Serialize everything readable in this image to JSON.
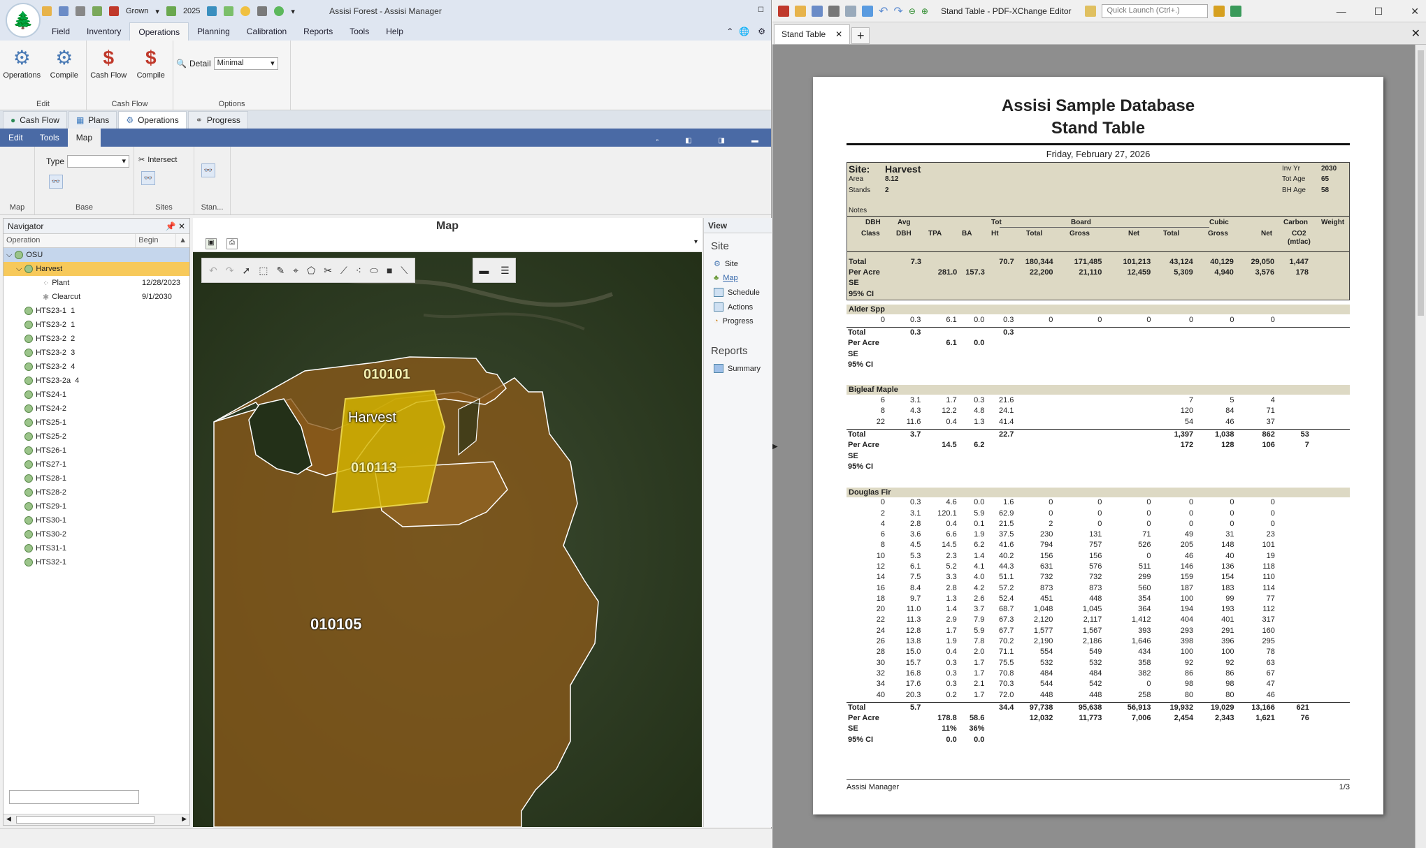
{
  "app": {
    "title": "Assisi Forest - Assisi Manager",
    "qat": {
      "grown_label": "Grown",
      "year": "2025"
    },
    "menu": [
      "Field",
      "Inventory",
      "Operations",
      "Planning",
      "Calibration",
      "Reports",
      "Tools",
      "Help"
    ],
    "active_menu": "Operations",
    "ribbon": {
      "edit": {
        "label": "Edit",
        "buttons": [
          "Operations",
          "Compile"
        ]
      },
      "cashflow": {
        "label": "Cash Flow",
        "buttons": [
          "Cash Flow",
          "Compile"
        ]
      },
      "options": {
        "label": "Options",
        "detail_label": "Detail",
        "detail_value": "Minimal"
      }
    },
    "doc_tabs": [
      "Cash Flow",
      "Plans",
      "Operations",
      "Progress"
    ],
    "active_doc_tab": "Operations",
    "sub_tabs": [
      "Edit",
      "Tools",
      "Map"
    ],
    "active_sub_tab": "Map",
    "sub_ribbon": {
      "map_label": "Map",
      "base_label": "Base",
      "type_label": "Type",
      "sites_label": "Sites",
      "intersect_label": "Intersect",
      "stand_label": "Stan..."
    },
    "navigator": {
      "title": "Navigator",
      "col_operation": "Operation",
      "col_begin": "Begin",
      "root": "OSU",
      "selected": "Harvest",
      "children": [
        {
          "label": "Plant",
          "date": "12/28/2023"
        },
        {
          "label": "Clearcut",
          "date": "9/1/2030"
        }
      ],
      "items": [
        "HTS23-1  1",
        "HTS23-2  1",
        "HTS23-2  2",
        "HTS23-2  3",
        "HTS23-2  4",
        "HTS23-2a  4",
        "HTS24-1",
        "HTS24-2",
        "HTS25-1",
        "HTS25-2",
        "HTS26-1",
        "HTS27-1",
        "HTS28-1",
        "HTS28-2",
        "HTS29-1",
        "HTS30-1",
        "HTS30-2",
        "HTS31-1",
        "HTS32-1"
      ]
    },
    "map": {
      "title": "Map",
      "labels": {
        "stand1": "010101",
        "stand2": "010113",
        "stand3": "010105",
        "harvest": "Harvest"
      }
    },
    "view": {
      "title": "View",
      "site_heading": "Site",
      "site_items": [
        "Site",
        "Map",
        "Schedule",
        "Actions",
        "Progress"
      ],
      "reports_heading": "Reports",
      "report_items": [
        "Summary"
      ]
    }
  },
  "pdf": {
    "window_title": "Stand Table - PDF-XChange Editor",
    "quick_launch": "Quick Launch (Ctrl+.)",
    "tab_label": "Stand Table",
    "report": {
      "title1": "Assisi Sample Database",
      "title2": "Stand Table",
      "date": "Friday, February 27, 2026",
      "site_label": "Site:",
      "site_name": "Harvest",
      "area_label": "Area",
      "area": "8.12",
      "stands_label": "Stands",
      "stands": "2",
      "inv_yr_label": "Inv Yr",
      "inv_yr": "2030",
      "tot_age_label": "Tot Age",
      "tot_age": "65",
      "bh_age_label": "BH Age",
      "bh_age": "58",
      "notes_label": "Notes",
      "group_headers": {
        "tot": "Tot",
        "board": "Board",
        "cubic": "Cubic",
        "carbon": "Carbon",
        "weight": "Weight"
      },
      "columns": [
        "DBH Class",
        "Avg DBH",
        "TPA",
        "BA",
        "Ht",
        "Total",
        "Gross",
        "Net",
        "Total",
        "Gross",
        "Net",
        "CO2 (mt/ac)"
      ],
      "col_top": {
        "dbh": "DBH",
        "avg": "Avg"
      },
      "col_bottom": {
        "class": "Class",
        "dbh": "DBH",
        "co2": "CO2",
        "mtac": "(mt/ac)"
      },
      "summary_rows": [
        [
          "Total",
          "7.3",
          "",
          "",
          "70.7",
          "180,344",
          "171,485",
          "101,213",
          "43,124",
          "40,129",
          "29,050",
          "1,447",
          ""
        ],
        [
          "Per Acre",
          "",
          "281.0",
          "157.3",
          "",
          "22,200",
          "21,110",
          "12,459",
          "5,309",
          "4,940",
          "3,576",
          "178",
          ""
        ],
        [
          "SE",
          "",
          "",
          "",
          "",
          "",
          "",
          "",
          "",
          "",
          "",
          "",
          ""
        ],
        [
          "95% CI",
          "",
          "",
          "",
          "",
          "",
          "",
          "",
          "",
          "",
          "",
          "",
          ""
        ]
      ],
      "species": [
        {
          "name": "Alder Spp",
          "rows": [
            [
              "0",
              "0.3",
              "6.1",
              "0.0",
              "0.3",
              "0",
              "0",
              "0",
              "0",
              "0",
              "0",
              "",
              ""
            ]
          ],
          "totals": [
            [
              "Total",
              "0.3",
              "",
              "",
              "0.3",
              "",
              "",
              "",
              "",
              "",
              "",
              "",
              ""
            ],
            [
              "Per Acre",
              "",
              "6.1",
              "0.0",
              "",
              "",
              "",
              "",
              "",
              "",
              "",
              "",
              ""
            ],
            [
              "SE",
              "",
              "",
              "",
              "",
              "",
              "",
              "",
              "",
              "",
              "",
              "",
              ""
            ],
            [
              "95% CI",
              "",
              "",
              "",
              "",
              "",
              "",
              "",
              "",
              "",
              "",
              "",
              ""
            ]
          ]
        },
        {
          "name": "Bigleaf Maple",
          "rows": [
            [
              "6",
              "3.1",
              "1.7",
              "0.3",
              "21.6",
              "",
              "",
              "",
              "7",
              "5",
              "4",
              "",
              ""
            ],
            [
              "8",
              "4.3",
              "12.2",
              "4.8",
              "24.1",
              "",
              "",
              "",
              "120",
              "84",
              "71",
              "",
              ""
            ],
            [
              "22",
              "11.6",
              "0.4",
              "1.3",
              "41.4",
              "",
              "",
              "",
              "54",
              "46",
              "37",
              "",
              ""
            ]
          ],
          "totals": [
            [
              "Total",
              "3.7",
              "",
              "",
              "22.7",
              "",
              "",
              "",
              "1,397",
              "1,038",
              "862",
              "53",
              ""
            ],
            [
              "Per Acre",
              "",
              "14.5",
              "6.2",
              "",
              "",
              "",
              "",
              "172",
              "128",
              "106",
              "7",
              ""
            ],
            [
              "SE",
              "",
              "",
              "",
              "",
              "",
              "",
              "",
              "",
              "",
              "",
              "",
              ""
            ],
            [
              "95% CI",
              "",
              "",
              "",
              "",
              "",
              "",
              "",
              "",
              "",
              "",
              "",
              ""
            ]
          ]
        },
        {
          "name": "Douglas Fir",
          "rows": [
            [
              "0",
              "0.3",
              "4.6",
              "0.0",
              "1.6",
              "0",
              "0",
              "0",
              "0",
              "0",
              "0",
              "",
              ""
            ],
            [
              "2",
              "3.1",
              "120.1",
              "5.9",
              "62.9",
              "0",
              "0",
              "0",
              "0",
              "0",
              "0",
              "",
              ""
            ],
            [
              "4",
              "2.8",
              "0.4",
              "0.1",
              "21.5",
              "2",
              "0",
              "0",
              "0",
              "0",
              "0",
              "",
              ""
            ],
            [
              "6",
              "3.6",
              "6.6",
              "1.9",
              "37.5",
              "230",
              "131",
              "71",
              "49",
              "31",
              "23",
              "",
              ""
            ],
            [
              "8",
              "4.5",
              "14.5",
              "6.2",
              "41.6",
              "794",
              "757",
              "526",
              "205",
              "148",
              "101",
              "",
              ""
            ],
            [
              "10",
              "5.3",
              "2.3",
              "1.4",
              "40.2",
              "156",
              "156",
              "0",
              "46",
              "40",
              "19",
              "",
              ""
            ],
            [
              "12",
              "6.1",
              "5.2",
              "4.1",
              "44.3",
              "631",
              "576",
              "511",
              "146",
              "136",
              "118",
              "",
              ""
            ],
            [
              "14",
              "7.5",
              "3.3",
              "4.0",
              "51.1",
              "732",
              "732",
              "299",
              "159",
              "154",
              "110",
              "",
              ""
            ],
            [
              "16",
              "8.4",
              "2.8",
              "4.2",
              "57.2",
              "873",
              "873",
              "560",
              "187",
              "183",
              "114",
              "",
              ""
            ],
            [
              "18",
              "9.7",
              "1.3",
              "2.6",
              "52.4",
              "451",
              "448",
              "354",
              "100",
              "99",
              "77",
              "",
              ""
            ],
            [
              "20",
              "11.0",
              "1.4",
              "3.7",
              "68.7",
              "1,048",
              "1,045",
              "364",
              "194",
              "193",
              "112",
              "",
              ""
            ],
            [
              "22",
              "11.3",
              "2.9",
              "7.9",
              "67.3",
              "2,120",
              "2,117",
              "1,412",
              "404",
              "401",
              "317",
              "",
              ""
            ],
            [
              "24",
              "12.8",
              "1.7",
              "5.9",
              "67.7",
              "1,577",
              "1,567",
              "393",
              "293",
              "291",
              "160",
              "",
              ""
            ],
            [
              "26",
              "13.8",
              "1.9",
              "7.8",
              "70.2",
              "2,190",
              "2,186",
              "1,646",
              "398",
              "396",
              "295",
              "",
              ""
            ],
            [
              "28",
              "15.0",
              "0.4",
              "2.0",
              "71.1",
              "554",
              "549",
              "434",
              "100",
              "100",
              "78",
              "",
              ""
            ],
            [
              "30",
              "15.7",
              "0.3",
              "1.7",
              "75.5",
              "532",
              "532",
              "358",
              "92",
              "92",
              "63",
              "",
              ""
            ],
            [
              "32",
              "16.8",
              "0.3",
              "1.7",
              "70.8",
              "484",
              "484",
              "382",
              "86",
              "86",
              "67",
              "",
              ""
            ],
            [
              "34",
              "17.6",
              "0.3",
              "2.1",
              "70.3",
              "544",
              "542",
              "0",
              "98",
              "98",
              "47",
              "",
              ""
            ],
            [
              "40",
              "20.3",
              "0.2",
              "1.7",
              "72.0",
              "448",
              "448",
              "258",
              "80",
              "80",
              "46",
              "",
              ""
            ]
          ],
          "totals": [
            [
              "Total",
              "5.7",
              "",
              "",
              "34.4",
              "97,738",
              "95,638",
              "56,913",
              "19,932",
              "19,029",
              "13,166",
              "621",
              ""
            ],
            [
              "Per Acre",
              "",
              "178.8",
              "58.6",
              "",
              "12,032",
              "11,773",
              "7,006",
              "2,454",
              "2,343",
              "1,621",
              "76",
              ""
            ],
            [
              "SE",
              "",
              "11%",
              "36%",
              "",
              "",
              "",
              "",
              "",
              "",
              "",
              "",
              ""
            ],
            [
              "95% CI",
              "",
              "0.0",
              "0.0",
              "",
              "",
              "",
              "",
              "",
              "",
              "",
              "",
              ""
            ]
          ]
        }
      ],
      "footer_left": "Assisi Manager",
      "footer_right": "1/3"
    }
  },
  "colors": {
    "ribbon_blue": "#4a6aa5",
    "harvest_yellow": "#d4b400",
    "stand_fill": "#8a5a1a",
    "report_shade": "#ddd9c4"
  }
}
